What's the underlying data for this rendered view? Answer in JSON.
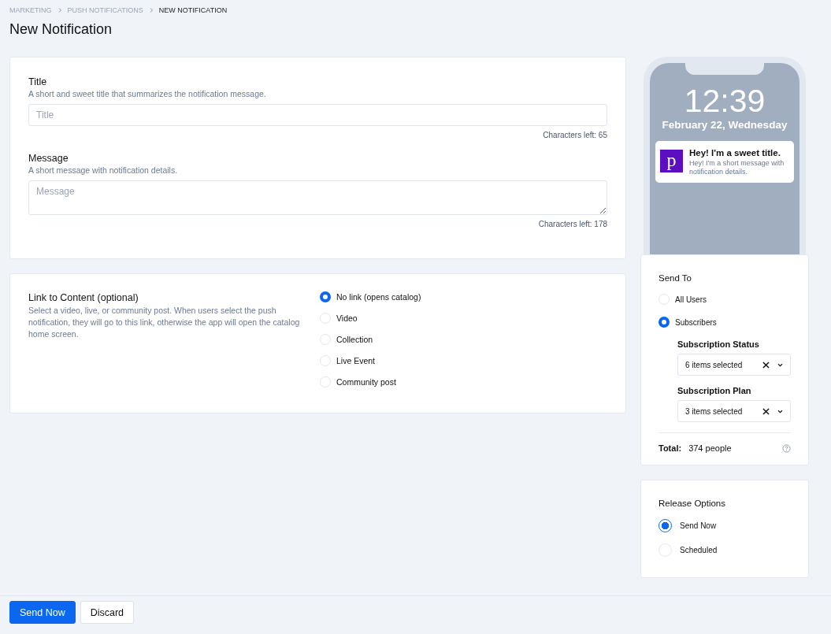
{
  "breadcrumbs": [
    {
      "label": "MARKETING",
      "current": false
    },
    {
      "label": "PUSH NOTIFICATIONS",
      "current": false
    },
    {
      "label": "NEW NOTIFICATION",
      "current": true
    }
  ],
  "page_title": "New Notification",
  "fields": [
    {
      "kind": "input",
      "label": "Title",
      "hint": "A short and sweet title that summarizes the notification message.",
      "placeholder": "Title",
      "counter": "Characters left: 65"
    },
    {
      "kind": "textarea",
      "label": "Message",
      "hint": "A short message with notification details.",
      "placeholder": "Message",
      "counter": "Characters left: 178"
    }
  ],
  "link_to_content": {
    "label": "Link to Content (optional)",
    "hint": "Select a video, live, or community post. When users select the push notification, they will go to this link, otherwise the app will open the catalog home screen.",
    "options": [
      {
        "label": "No link (opens catalog)",
        "selected": true
      },
      {
        "label": "Video",
        "selected": false
      },
      {
        "label": "Collection",
        "selected": false
      },
      {
        "label": "Live Event",
        "selected": false
      },
      {
        "label": "Community post",
        "selected": false
      }
    ]
  },
  "preview": {
    "time": "12:39",
    "date": "February 22, Wednesday",
    "app_letter": "p",
    "title": "Hey! I'm a sweet title.",
    "message": "Hey! I'm a short message with notification details."
  },
  "send_to": {
    "heading": "Send To",
    "options": [
      {
        "label": "All Users",
        "selected": false
      },
      {
        "label": "Subscribers",
        "selected": true
      }
    ],
    "filters": [
      {
        "label": "Subscription Status",
        "value": "6 items selected"
      },
      {
        "label": "Subscription Plan",
        "value": "3 items selected"
      }
    ],
    "total_label": "Total:",
    "total_value": "374 people"
  },
  "release_options": {
    "heading": "Release Options",
    "options": [
      {
        "label": "Send Now",
        "selected": true
      },
      {
        "label": "Scheduled",
        "selected": false
      }
    ]
  },
  "buttons": [
    {
      "label": "Send Now",
      "kind": "primary"
    },
    {
      "label": "Discard",
      "kind": "secondary"
    }
  ]
}
